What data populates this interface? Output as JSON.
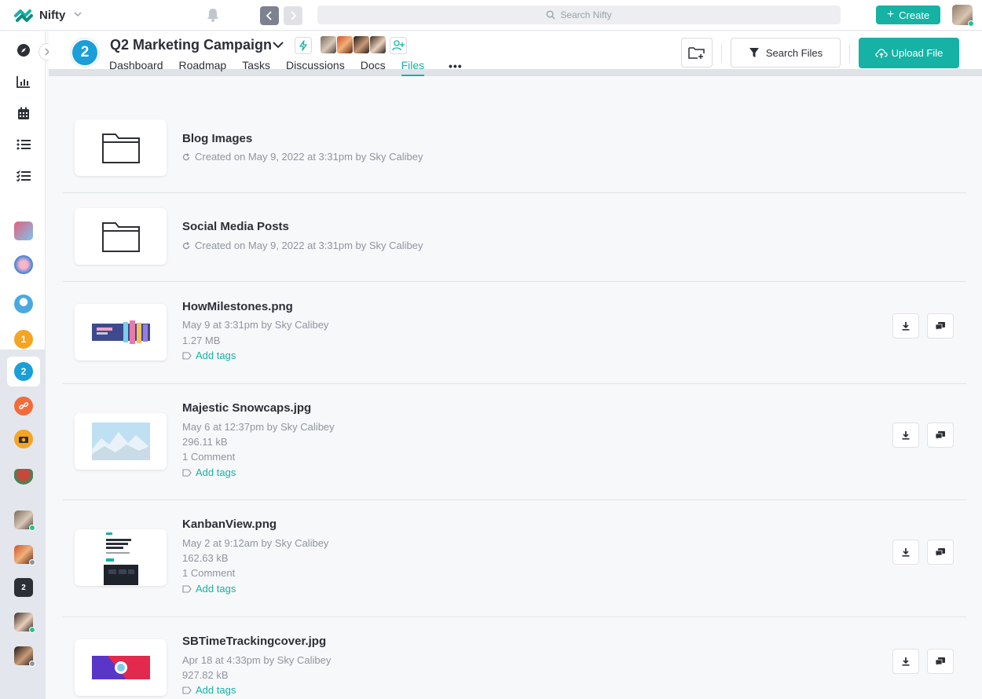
{
  "app": {
    "name": "Nifty"
  },
  "topbar": {
    "search_placeholder": "Search Nifty",
    "create_label": "Create"
  },
  "project": {
    "number": "2",
    "title": "Q2 Marketing Campaign",
    "tabs": [
      {
        "label": "Dashboard"
      },
      {
        "label": "Roadmap"
      },
      {
        "label": "Tasks"
      },
      {
        "label": "Discussions"
      },
      {
        "label": "Docs"
      },
      {
        "label": "Files",
        "active": true
      }
    ],
    "more_label": "•••"
  },
  "actions": {
    "search_files_label": "Search Files",
    "upload_label": "Upload File"
  },
  "sidebar": {
    "project_badges": [
      {
        "label": "1",
        "color": "#f5a524"
      },
      {
        "label": "2",
        "color": "#1a9fd9",
        "active": true
      }
    ],
    "dm_badge": "2"
  },
  "items": [
    {
      "type": "folder",
      "name": "Blog Images",
      "meta": "Created on May 9, 2022 at 3:31pm by Sky Calibey"
    },
    {
      "type": "folder",
      "name": "Social Media Posts",
      "meta": "Created on May 9, 2022 at 3:31pm by Sky Calibey"
    },
    {
      "type": "file",
      "name": "HowMilestones.png",
      "date": "May 9 at 3:31pm by Sky Calibey",
      "size": "1.27 MB",
      "comments": "",
      "tags_label": "Add tags"
    },
    {
      "type": "file",
      "name": "Majestic Snowcaps.jpg",
      "date": "May 6 at 12:37pm by Sky Calibey",
      "size": "296.11 kB",
      "comments": "1 Comment",
      "tags_label": "Add tags"
    },
    {
      "type": "file",
      "name": "KanbanView.png",
      "date": "May 2 at 9:12am by Sky Calibey",
      "size": "162.63 kB",
      "comments": "1 Comment",
      "tags_label": "Add tags"
    },
    {
      "type": "file",
      "name": "SBTimeTrackingcover.jpg",
      "date": "Apr 18 at 4:33pm by Sky Calibey",
      "size": "927.82 kB",
      "comments": "",
      "tags_label": "Add tags"
    }
  ],
  "colors": {
    "accent": "#15b2a5",
    "project_blue": "#1a9fd9"
  }
}
